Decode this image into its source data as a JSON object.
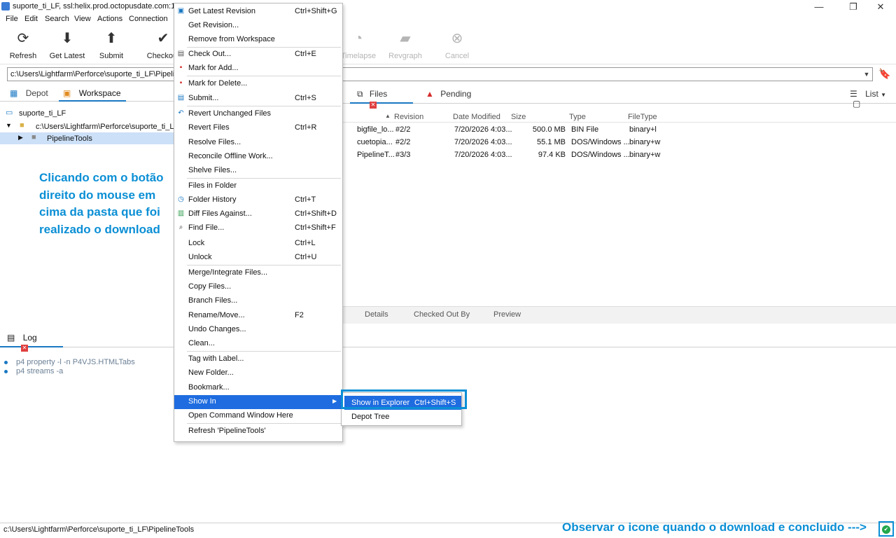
{
  "window": {
    "title": "suporte_ti_LF,  ssl:helix.prod.octopusdate.com:1666,",
    "controls": {
      "minimize": "—",
      "maximize": "❐",
      "close": "✕"
    }
  },
  "menubar": [
    "File",
    "Edit",
    "Search",
    "View",
    "Actions",
    "Connection"
  ],
  "toolbar": [
    {
      "label": "Refresh",
      "icon": "refresh-icon",
      "glyph": "⟳"
    },
    {
      "label": "Get Latest",
      "icon": "download-icon",
      "glyph": "⬇"
    },
    {
      "label": "Submit",
      "icon": "upload-icon",
      "glyph": "⬆"
    },
    {
      "label": "Checkout",
      "icon": "checkmark-icon",
      "glyph": "✔"
    },
    {
      "label": "Timelapse",
      "icon": "timelapse-icon",
      "glyph": "◔"
    },
    {
      "label": "Revgraph",
      "icon": "revgraph-icon",
      "glyph": "▰"
    },
    {
      "label": "Cancel",
      "icon": "cancel-icon",
      "glyph": "⊗"
    }
  ],
  "path": "c:\\Users\\Lightfarm\\Perforce\\suporte_ti_LF\\PipelineTools",
  "left_tabs": [
    "Depot",
    "Workspace"
  ],
  "tree": {
    "workspace": "suporte_ti_LF",
    "root": "c:\\Users\\Lightfarm\\Perforce\\suporte_ti_LF",
    "folder": "PipelineTools"
  },
  "annotation_left": "Clicando com o botão direito do mouse em cima da pasta que foi realizado o download",
  "right_tabs": [
    "Files",
    "Pending"
  ],
  "view_mode": "List",
  "columns": [
    "Revision",
    "Date Modified",
    "Size",
    "Type",
    "FileType"
  ],
  "files": [
    {
      "name": "bigfile_lo...",
      "rev": "#2/2",
      "date": "7/20/2026 4:03...",
      "size": "500.0 MB",
      "type": "BIN File",
      "filetype": "binary+l"
    },
    {
      "name": "cuetopia...",
      "rev": "#2/2",
      "date": "7/20/2026 4:03...",
      "size": "55.1 MB",
      "type": "DOS/Windows ...",
      "filetype": "binary+w"
    },
    {
      "name": "PipelineT...",
      "rev": "#3/3",
      "date": "7/20/2026 4:03...",
      "size": "97.4 KB",
      "type": "DOS/Windows ...",
      "filetype": "binary+w"
    }
  ],
  "bottom_tabs": [
    "Details",
    "Checked Out By",
    "Preview"
  ],
  "log": {
    "tab": "Log",
    "lines": [
      "p4 property -l -n P4VJS.HTMLTabs",
      "p4 streams -a"
    ]
  },
  "context_menu": [
    {
      "label": "Get Latest Revision",
      "shortcut": "Ctrl+Shift+G",
      "icon": "get-latest-icon"
    },
    {
      "label": "Get Revision...",
      "shortcut": ""
    },
    {
      "label": "Remove from Workspace",
      "shortcut": ""
    },
    {
      "label": "Check Out...",
      "shortcut": "Ctrl+E",
      "icon": "checkout-icon",
      "sep_before": true
    },
    {
      "label": "Mark for Add...",
      "shortcut": "",
      "icon": "mark-add-icon"
    },
    {
      "label": "Mark for Delete...",
      "shortcut": "",
      "icon": "mark-delete-icon",
      "sep_before": true
    },
    {
      "label": "Submit...",
      "shortcut": "Ctrl+S",
      "icon": "submit-icon"
    },
    {
      "label": "Revert Unchanged Files",
      "shortcut": "",
      "icon": "revert-icon",
      "sep_before": true
    },
    {
      "label": "Revert Files",
      "shortcut": "Ctrl+R"
    },
    {
      "label": "Resolve Files...",
      "shortcut": ""
    },
    {
      "label": "Reconcile Offline Work...",
      "shortcut": ""
    },
    {
      "label": "Shelve Files...",
      "shortcut": ""
    },
    {
      "label": "Files in Folder",
      "shortcut": "",
      "sep_before": true
    },
    {
      "label": "Folder History",
      "shortcut": "Ctrl+T",
      "icon": "history-icon"
    },
    {
      "label": "Diff Files Against...",
      "shortcut": "Ctrl+Shift+D",
      "icon": "diff-icon"
    },
    {
      "label": "Find File...",
      "shortcut": "Ctrl+Shift+F",
      "icon": "find-icon"
    },
    {
      "label": "Lock",
      "shortcut": "Ctrl+L"
    },
    {
      "label": "Unlock",
      "shortcut": "Ctrl+U"
    },
    {
      "label": "Merge/Integrate Files...",
      "shortcut": "",
      "sep_before": true
    },
    {
      "label": "Copy Files...",
      "shortcut": ""
    },
    {
      "label": "Branch Files...",
      "shortcut": ""
    },
    {
      "label": "Rename/Move...",
      "shortcut": "F2"
    },
    {
      "label": "Undo Changes...",
      "shortcut": ""
    },
    {
      "label": "Clean...",
      "shortcut": ""
    },
    {
      "label": "Tag with Label...",
      "shortcut": "",
      "sep_before": true
    },
    {
      "label": "New Folder...",
      "shortcut": ""
    },
    {
      "label": "Bookmark...",
      "shortcut": ""
    },
    {
      "label": "Show In",
      "shortcut": "",
      "submenu": true,
      "highlighted": true
    },
    {
      "label": "Open Command Window Here",
      "shortcut": ""
    },
    {
      "label": "Refresh 'PipelineTools'",
      "shortcut": "",
      "sep_before": true
    }
  ],
  "submenu": [
    {
      "label": "Show in Explorer",
      "shortcut": "Ctrl+Shift+S",
      "highlighted": true
    },
    {
      "label": "Depot Tree",
      "shortcut": ""
    }
  ],
  "status": {
    "path": "c:\\Users\\Lightfarm\\Perforce\\suporte_ti_LF\\PipelineTools",
    "annotation": "Observar o icone quando o download e concluido --->"
  }
}
